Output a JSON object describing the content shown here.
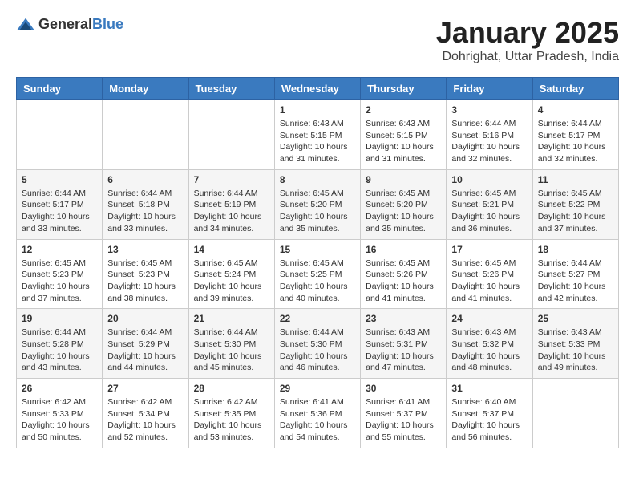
{
  "logo": {
    "general": "General",
    "blue": "Blue"
  },
  "title": "January 2025",
  "location": "Dohrighat, Uttar Pradesh, India",
  "days_of_week": [
    "Sunday",
    "Monday",
    "Tuesday",
    "Wednesday",
    "Thursday",
    "Friday",
    "Saturday"
  ],
  "weeks": [
    [
      {
        "day": "",
        "info": ""
      },
      {
        "day": "",
        "info": ""
      },
      {
        "day": "",
        "info": ""
      },
      {
        "day": "1",
        "info": "Sunrise: 6:43 AM\nSunset: 5:15 PM\nDaylight: 10 hours\nand 31 minutes."
      },
      {
        "day": "2",
        "info": "Sunrise: 6:43 AM\nSunset: 5:15 PM\nDaylight: 10 hours\nand 31 minutes."
      },
      {
        "day": "3",
        "info": "Sunrise: 6:44 AM\nSunset: 5:16 PM\nDaylight: 10 hours\nand 32 minutes."
      },
      {
        "day": "4",
        "info": "Sunrise: 6:44 AM\nSunset: 5:17 PM\nDaylight: 10 hours\nand 32 minutes."
      }
    ],
    [
      {
        "day": "5",
        "info": "Sunrise: 6:44 AM\nSunset: 5:17 PM\nDaylight: 10 hours\nand 33 minutes."
      },
      {
        "day": "6",
        "info": "Sunrise: 6:44 AM\nSunset: 5:18 PM\nDaylight: 10 hours\nand 33 minutes."
      },
      {
        "day": "7",
        "info": "Sunrise: 6:44 AM\nSunset: 5:19 PM\nDaylight: 10 hours\nand 34 minutes."
      },
      {
        "day": "8",
        "info": "Sunrise: 6:45 AM\nSunset: 5:20 PM\nDaylight: 10 hours\nand 35 minutes."
      },
      {
        "day": "9",
        "info": "Sunrise: 6:45 AM\nSunset: 5:20 PM\nDaylight: 10 hours\nand 35 minutes."
      },
      {
        "day": "10",
        "info": "Sunrise: 6:45 AM\nSunset: 5:21 PM\nDaylight: 10 hours\nand 36 minutes."
      },
      {
        "day": "11",
        "info": "Sunrise: 6:45 AM\nSunset: 5:22 PM\nDaylight: 10 hours\nand 37 minutes."
      }
    ],
    [
      {
        "day": "12",
        "info": "Sunrise: 6:45 AM\nSunset: 5:23 PM\nDaylight: 10 hours\nand 37 minutes."
      },
      {
        "day": "13",
        "info": "Sunrise: 6:45 AM\nSunset: 5:23 PM\nDaylight: 10 hours\nand 38 minutes."
      },
      {
        "day": "14",
        "info": "Sunrise: 6:45 AM\nSunset: 5:24 PM\nDaylight: 10 hours\nand 39 minutes."
      },
      {
        "day": "15",
        "info": "Sunrise: 6:45 AM\nSunset: 5:25 PM\nDaylight: 10 hours\nand 40 minutes."
      },
      {
        "day": "16",
        "info": "Sunrise: 6:45 AM\nSunset: 5:26 PM\nDaylight: 10 hours\nand 41 minutes."
      },
      {
        "day": "17",
        "info": "Sunrise: 6:45 AM\nSunset: 5:26 PM\nDaylight: 10 hours\nand 41 minutes."
      },
      {
        "day": "18",
        "info": "Sunrise: 6:44 AM\nSunset: 5:27 PM\nDaylight: 10 hours\nand 42 minutes."
      }
    ],
    [
      {
        "day": "19",
        "info": "Sunrise: 6:44 AM\nSunset: 5:28 PM\nDaylight: 10 hours\nand 43 minutes."
      },
      {
        "day": "20",
        "info": "Sunrise: 6:44 AM\nSunset: 5:29 PM\nDaylight: 10 hours\nand 44 minutes."
      },
      {
        "day": "21",
        "info": "Sunrise: 6:44 AM\nSunset: 5:30 PM\nDaylight: 10 hours\nand 45 minutes."
      },
      {
        "day": "22",
        "info": "Sunrise: 6:44 AM\nSunset: 5:30 PM\nDaylight: 10 hours\nand 46 minutes."
      },
      {
        "day": "23",
        "info": "Sunrise: 6:43 AM\nSunset: 5:31 PM\nDaylight: 10 hours\nand 47 minutes."
      },
      {
        "day": "24",
        "info": "Sunrise: 6:43 AM\nSunset: 5:32 PM\nDaylight: 10 hours\nand 48 minutes."
      },
      {
        "day": "25",
        "info": "Sunrise: 6:43 AM\nSunset: 5:33 PM\nDaylight: 10 hours\nand 49 minutes."
      }
    ],
    [
      {
        "day": "26",
        "info": "Sunrise: 6:42 AM\nSunset: 5:33 PM\nDaylight: 10 hours\nand 50 minutes."
      },
      {
        "day": "27",
        "info": "Sunrise: 6:42 AM\nSunset: 5:34 PM\nDaylight: 10 hours\nand 52 minutes."
      },
      {
        "day": "28",
        "info": "Sunrise: 6:42 AM\nSunset: 5:35 PM\nDaylight: 10 hours\nand 53 minutes."
      },
      {
        "day": "29",
        "info": "Sunrise: 6:41 AM\nSunset: 5:36 PM\nDaylight: 10 hours\nand 54 minutes."
      },
      {
        "day": "30",
        "info": "Sunrise: 6:41 AM\nSunset: 5:37 PM\nDaylight: 10 hours\nand 55 minutes."
      },
      {
        "day": "31",
        "info": "Sunrise: 6:40 AM\nSunset: 5:37 PM\nDaylight: 10 hours\nand 56 minutes."
      },
      {
        "day": "",
        "info": ""
      }
    ]
  ]
}
